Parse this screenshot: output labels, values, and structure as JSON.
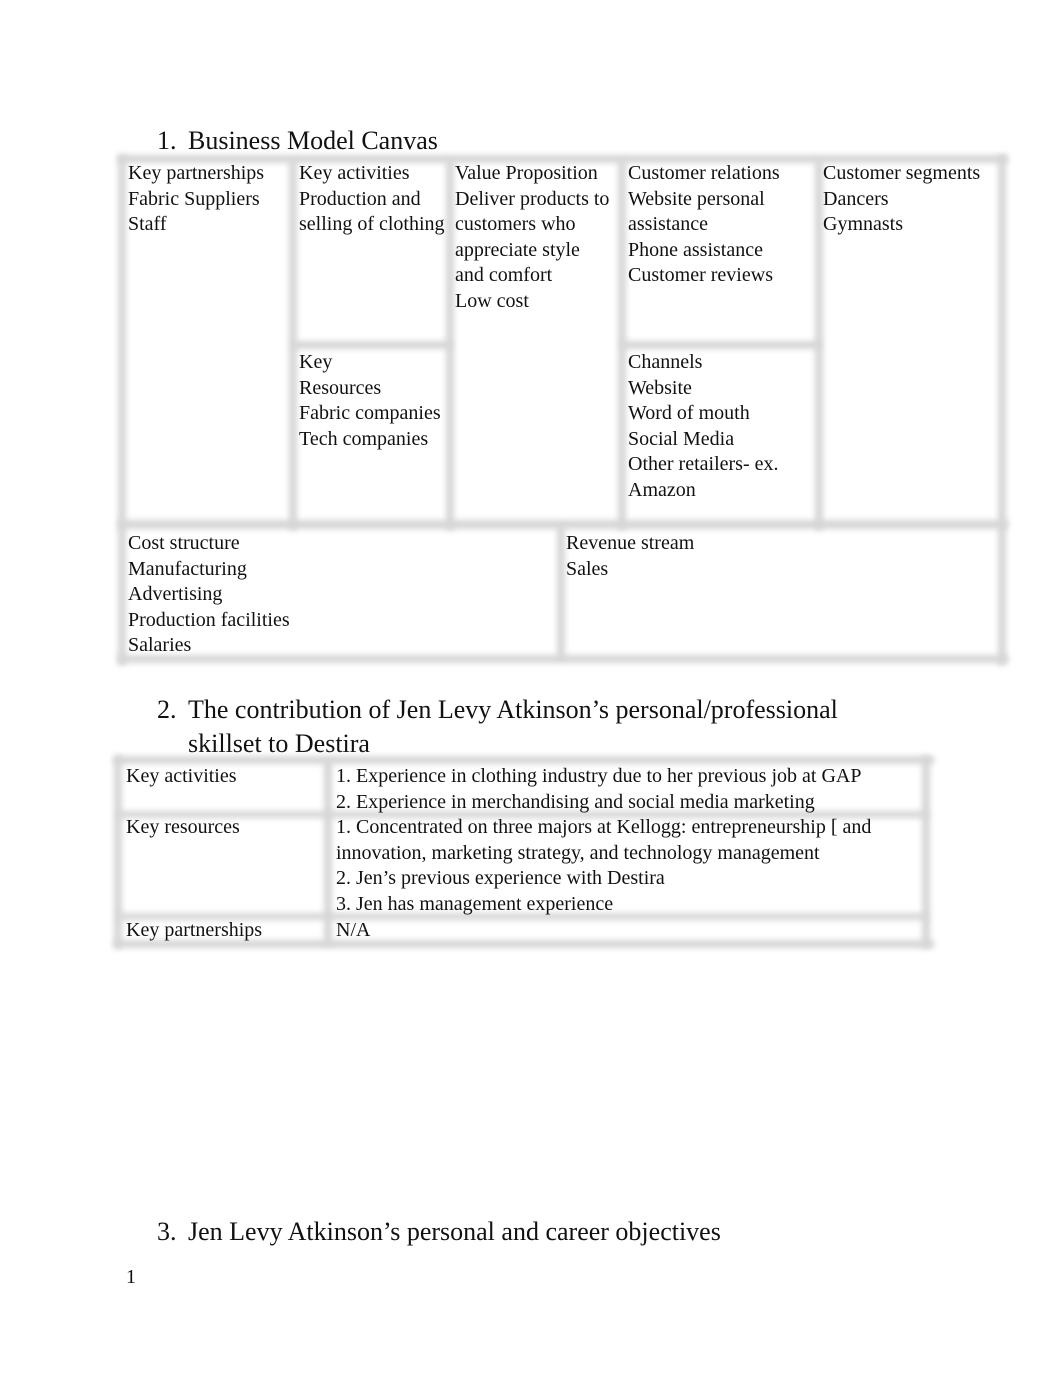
{
  "sections": [
    {
      "number": "1.",
      "title": "Business Model Canvas"
    },
    {
      "number": "2.",
      "title": "The contribution of Jen Levy Atkinson’s personal/professional skillset to Destira"
    },
    {
      "number": "3.",
      "title": "Jen Levy Atkinson’s personal and career objectives"
    }
  ],
  "canvas": {
    "key_partnerships": {
      "title": "Key partnerships",
      "items": [
        "Fabric Suppliers",
        "Staff"
      ]
    },
    "key_activities": {
      "title": "Key activities",
      "items": [
        "Production and",
        "selling of clothing"
      ]
    },
    "key_resources": {
      "title_lines": [
        "Key",
        "Resources"
      ],
      "items": [
        "Fabric companies",
        "Tech companies"
      ]
    },
    "value_proposition": {
      "title": "Value Proposition",
      "items": [
        "Deliver products to",
        "customers who",
        "appreciate style",
        "and comfort",
        "Low cost"
      ]
    },
    "customer_relations": {
      "title": "Customer relations",
      "items": [
        "Website personal",
        "assistance",
        "Phone assistance",
        "Customer reviews"
      ]
    },
    "channels": {
      "title": "Channels",
      "items": [
        "Website",
        "Word of mouth",
        "Social Media",
        "Other retailers- ex.",
        "Amazon"
      ]
    },
    "customer_segments": {
      "title": "Customer segments",
      "items": [
        "Dancers",
        "Gymnasts"
      ]
    },
    "cost_structure": {
      "title": "Cost structure",
      "items": [
        "Manufacturing",
        "Advertising",
        "Production facilities",
        "Salaries"
      ]
    },
    "revenue_stream": {
      "title": "Revenue stream",
      "items": [
        "Sales"
      ]
    }
  },
  "skillset_table": {
    "rows": [
      {
        "label": "Key activities",
        "lines": [
          "1. Experience in clothing industry due to her previous job at GAP",
          "2. Experience in merchandising and social media marketing"
        ]
      },
      {
        "label": "Key resources",
        "lines": [
          "1. Concentrated on three majors at Kellogg: entrepreneurship [ and",
          "innovation, marketing strategy, and technology management",
          "2. Jen’s previous experience with Destira",
          "3. Jen has management experience"
        ]
      },
      {
        "label": "Key partnerships",
        "lines": [
          "N/A"
        ]
      }
    ]
  },
  "page_number": "1"
}
